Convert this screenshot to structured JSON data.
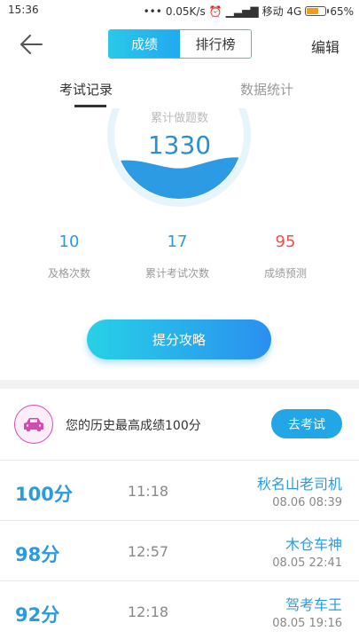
{
  "status_bar": {
    "time": "15:36",
    "network_speed": "0.05K/s",
    "carrier": "移动 4G",
    "battery": "65%",
    "battery_level": 0.65
  },
  "header": {
    "tabs": [
      "成绩",
      "排行榜"
    ],
    "active_tab": "成绩",
    "edit_label": "编辑"
  },
  "sub_tabs": {
    "items": [
      "考试记录",
      "数据统计"
    ],
    "active": "考试记录"
  },
  "gauge": {
    "label": "累计做题数",
    "value": "1330"
  },
  "stats": [
    {
      "value": "10",
      "label": "及格次数",
      "color": "#2a9be0"
    },
    {
      "value": "17",
      "label": "累计考试次数",
      "color": "#2a9be0"
    },
    {
      "value": "95",
      "label": "成绩预测",
      "color": "#e9534f"
    }
  ],
  "cta_label": "提分攻略",
  "best": {
    "text": "您的历史最高成绩100分",
    "button_label": "去考试"
  },
  "records": [
    {
      "score": "100分",
      "time": "11:18",
      "title": "秋名山老司机",
      "date": "08.06  08:39"
    },
    {
      "score": "98分",
      "time": "12:57",
      "title": "木仓车神",
      "date": "08.05  22:41"
    },
    {
      "score": "92分",
      "time": "12:18",
      "title": "驾考车王",
      "date": "08.05  19:16"
    }
  ],
  "colors": {
    "accent": "#22a6e6",
    "score_blue": "#2a9be0",
    "prediction_red": "#e9534f"
  }
}
